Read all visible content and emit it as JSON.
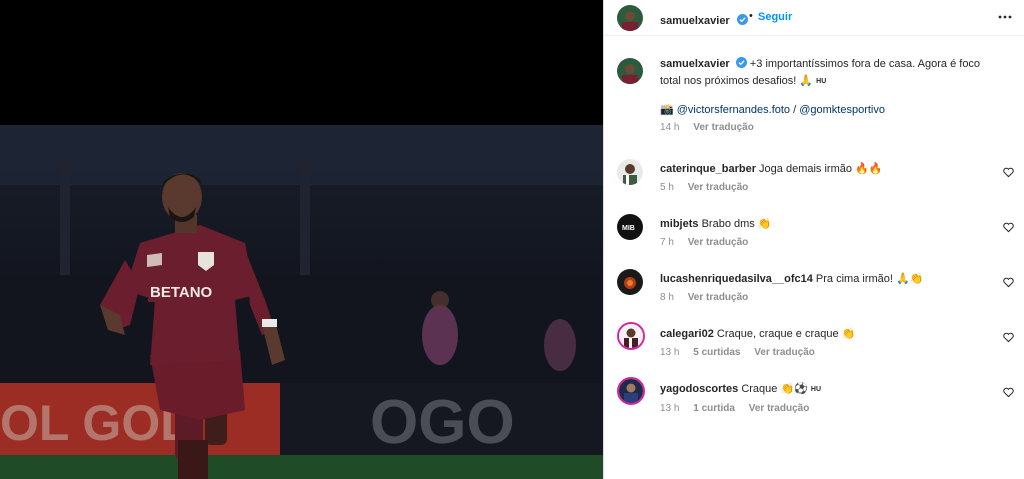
{
  "post": {
    "username": "samuelxavier",
    "follow_label": "Seguir",
    "dot": "•",
    "caption_line1": "+3 importantíssimos fora de casa. Agora é foco",
    "caption_line2": "total nos próximos desafios! 🙏",
    "caption_hu": "HU",
    "credit_icon": "📸",
    "credit_user1": "@victorsfernandes.foto",
    "credit_sep": "/",
    "credit_user2": "@gomktesportivo",
    "time": "14 h",
    "translate": "Ver tradução"
  },
  "photo": {
    "sponsor": "BETANO",
    "board_text_left": "OL GOL",
    "board_text_right": "OGO"
  },
  "comments": [
    {
      "username": "caterinque_barber",
      "text": "Joga demais irmão 🔥🔥",
      "time": "5 h",
      "replies": "",
      "translate": "Ver tradução"
    },
    {
      "username": "mibjets",
      "text": "Brabo dms 👏",
      "time": "7 h",
      "replies": "",
      "translate": "Ver tradução",
      "avatar_text": "MIB"
    },
    {
      "username": "lucashenriquedasilva__ofc14",
      "text": "Pra cima irmão! 🙏👏",
      "time": "8 h",
      "replies": "",
      "translate": "Ver tradução"
    },
    {
      "username": "calegari02",
      "text": "Craque, craque e craque 👏",
      "time": "13 h",
      "replies": "5 curtidas",
      "translate": "Ver tradução"
    },
    {
      "username": "yagodoscortes",
      "text": "Craque 👏⚽",
      "hu": "HU",
      "time": "13 h",
      "replies": "1 curtida",
      "translate": "Ver tradução"
    }
  ],
  "colors": {
    "accent": "#0095f6",
    "verified": "#3897f0",
    "jersey": "#6b1f2e"
  },
  "icons": {
    "more": "more-options-icon",
    "heart": "heart-icon",
    "verified": "verified-badge-icon"
  }
}
